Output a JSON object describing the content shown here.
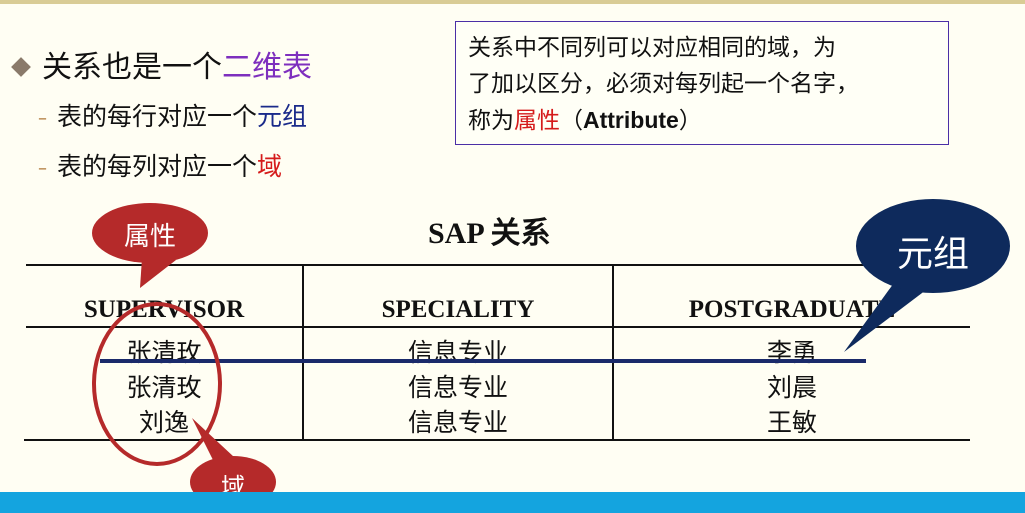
{
  "bullet_main": {
    "prefix": "关系也是一个",
    "highlight": "二维表"
  },
  "sub_items": [
    {
      "prefix": "表的每行对应一个",
      "highlight": "元组"
    },
    {
      "prefix": "表的每列对应一个",
      "highlight": "域"
    }
  ],
  "note": {
    "line1": "关系中不同列可以对应相同的域，为",
    "line2": "了加以区分，必须对每列起一个名字，",
    "line3_prefix": "称为",
    "line3_highlight": "属性",
    "line3_paren_open": "（",
    "line3_bold": "Attribute",
    "line3_paren_close": "）"
  },
  "table": {
    "title": "SAP 关系",
    "headers": [
      "SUPERVISOR",
      "SPECIALITY",
      "POSTGRADUATE"
    ],
    "rows": [
      [
        "张清玫",
        "信息专业",
        "李勇"
      ],
      [
        "张清玫",
        "信息专业",
        "刘晨"
      ],
      [
        "刘逸",
        "信息专业",
        "王敏"
      ]
    ]
  },
  "callouts": {
    "attribute": "属性",
    "tuple": "元组",
    "domain": "域"
  },
  "colors": {
    "purple": "#7e2fbe",
    "navy": "#1a2a8a",
    "red": "#d51b1b",
    "callout_red": "#b52a2a",
    "callout_navy": "#0e2a5c",
    "bottom_bar": "#14a4df"
  }
}
